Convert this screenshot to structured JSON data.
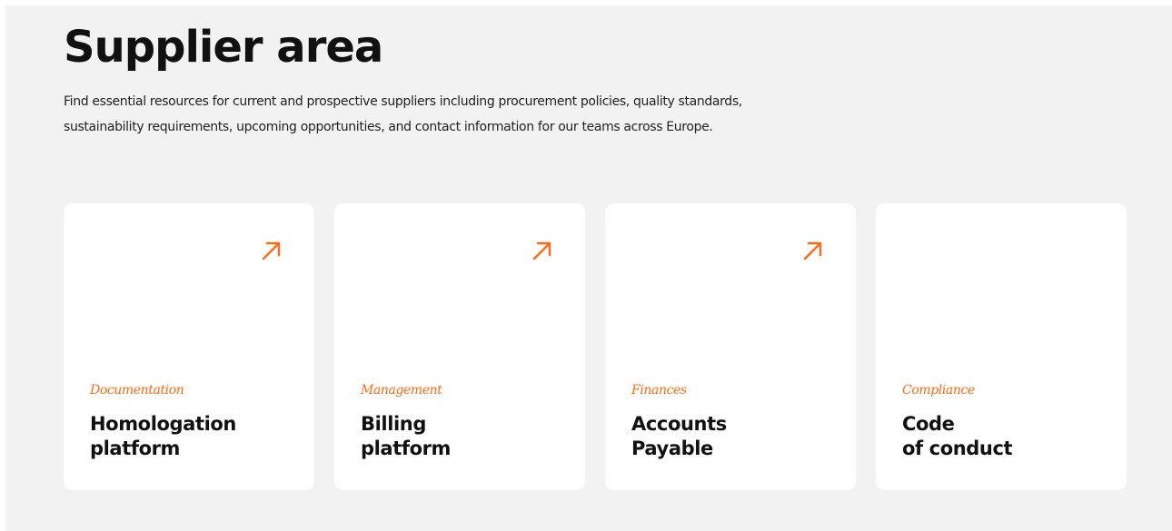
{
  "section": {
    "title": "Supplier area",
    "description": "Find essential resources for current and prospective suppliers including procurement policies, quality standards, sustainability requirements, upcoming opportunities, and contact information for our teams across Europe."
  },
  "cards": [
    {
      "category": "Documentation",
      "title_line1": "Homologation",
      "title_line2": "platform",
      "external_link": true,
      "arrow_icon": "arrow-up-right-icon"
    },
    {
      "category": "Management",
      "title_line1": "Billing",
      "title_line2": "platform",
      "external_link": true,
      "arrow_icon": "arrow-up-right-icon"
    },
    {
      "category": "Finances",
      "title_line1": "Accounts",
      "title_line2": "Payable",
      "external_link": true,
      "arrow_icon": "arrow-up-right-icon"
    },
    {
      "category": "Compliance",
      "title_line1": "Code",
      "title_line2": "of conduct",
      "external_link": false
    }
  ],
  "colors": {
    "accent": "#ff6a13",
    "background": "#f2f2f2",
    "card": "#ffffff",
    "text": "#111111"
  }
}
